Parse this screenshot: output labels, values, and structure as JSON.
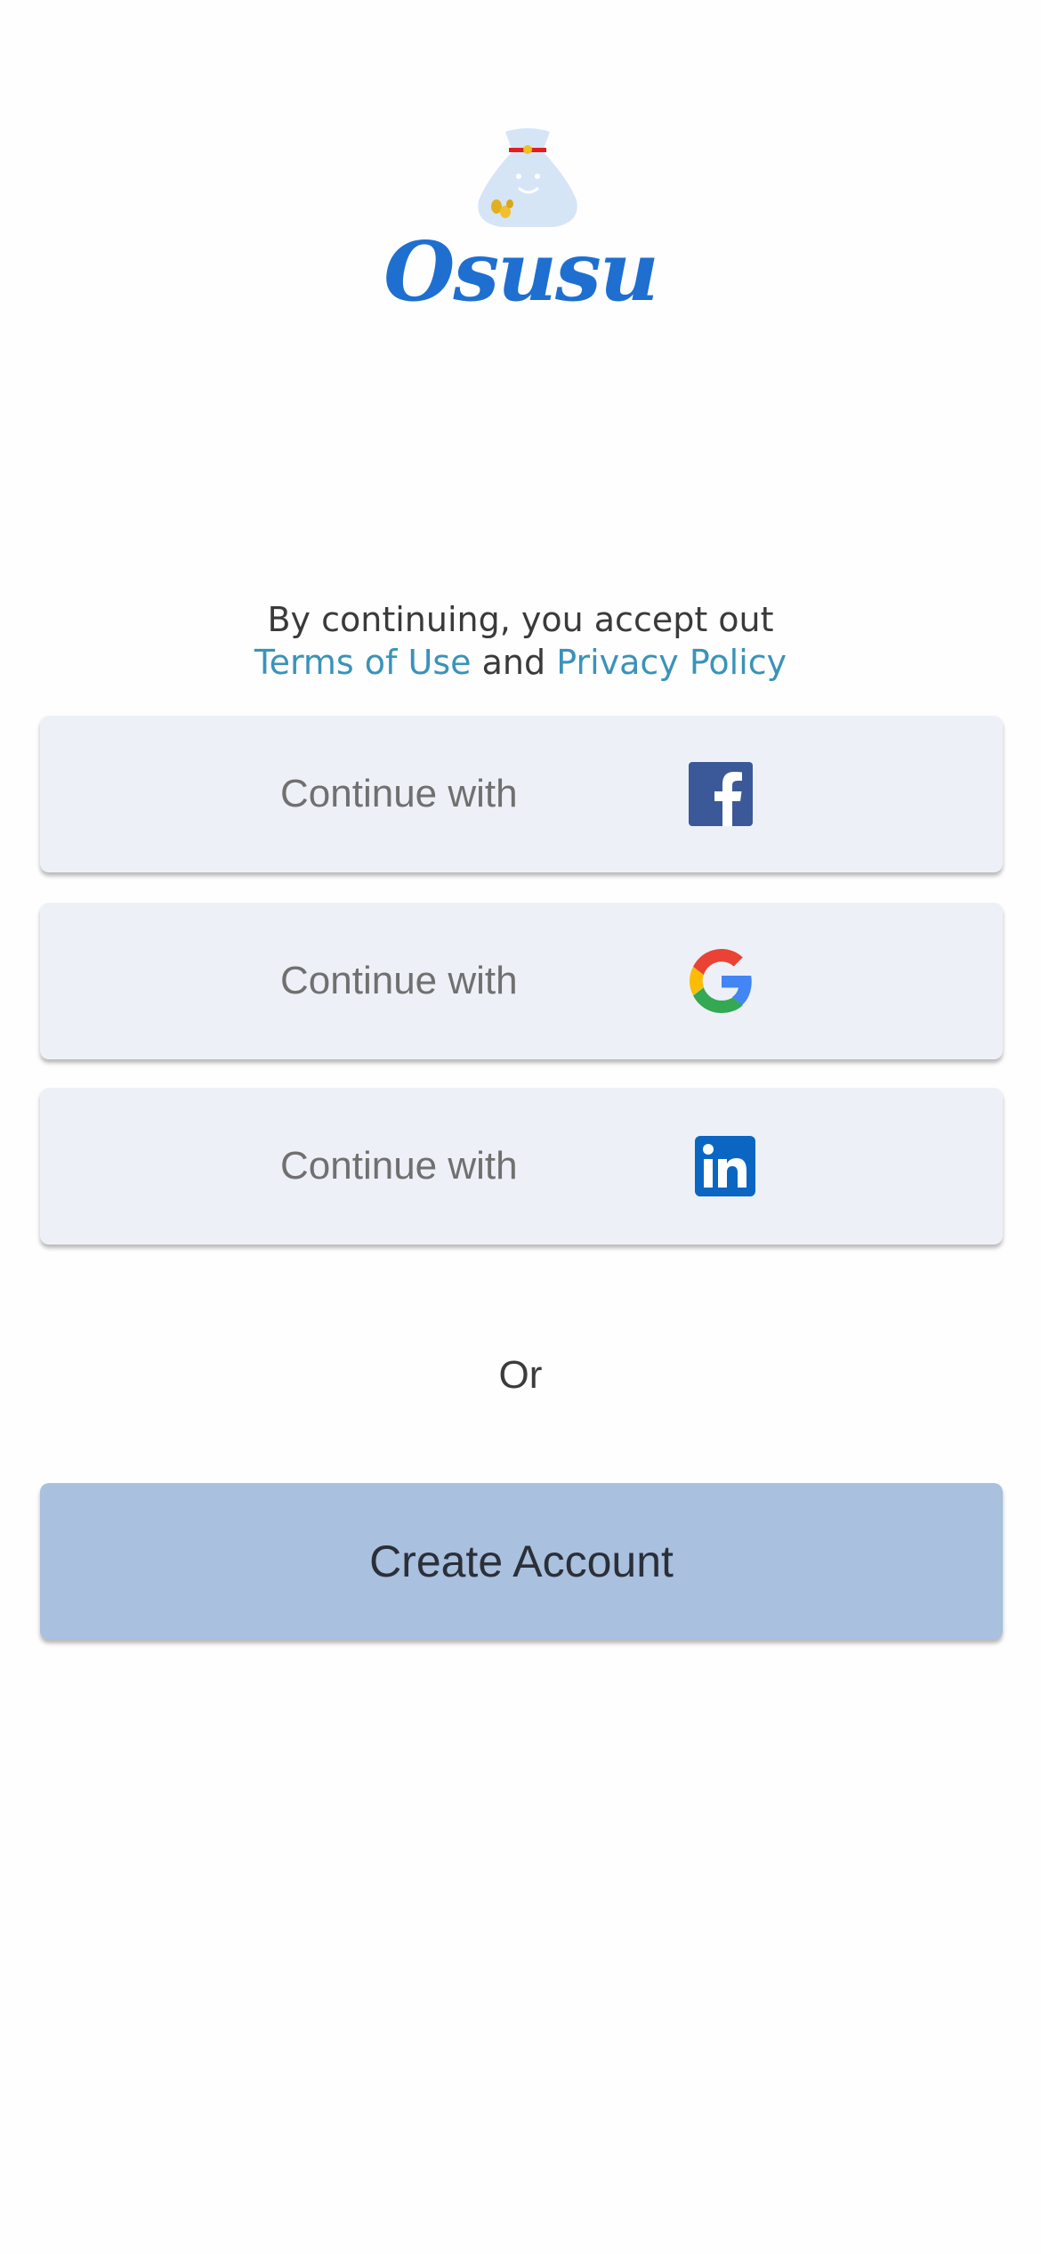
{
  "brand": {
    "name": "Osusu",
    "color": "#1e6fd0",
    "logo_icon": "money-bag-icon"
  },
  "terms": {
    "line1": "By continuing, you accept out",
    "terms_link": "Terms of Use",
    "and": "and",
    "privacy_link": "Privacy Policy",
    "link_color": "#3a93b8"
  },
  "auth_buttons": [
    {
      "label": "Continue with",
      "icon": "facebook-icon"
    },
    {
      "label": "Continue with",
      "icon": "google-icon"
    },
    {
      "label": "Continue with",
      "icon": "linkedin-icon"
    }
  ],
  "divider": {
    "label": "Or"
  },
  "create_account": {
    "label": "Create Account",
    "color": "#a9c0df"
  }
}
